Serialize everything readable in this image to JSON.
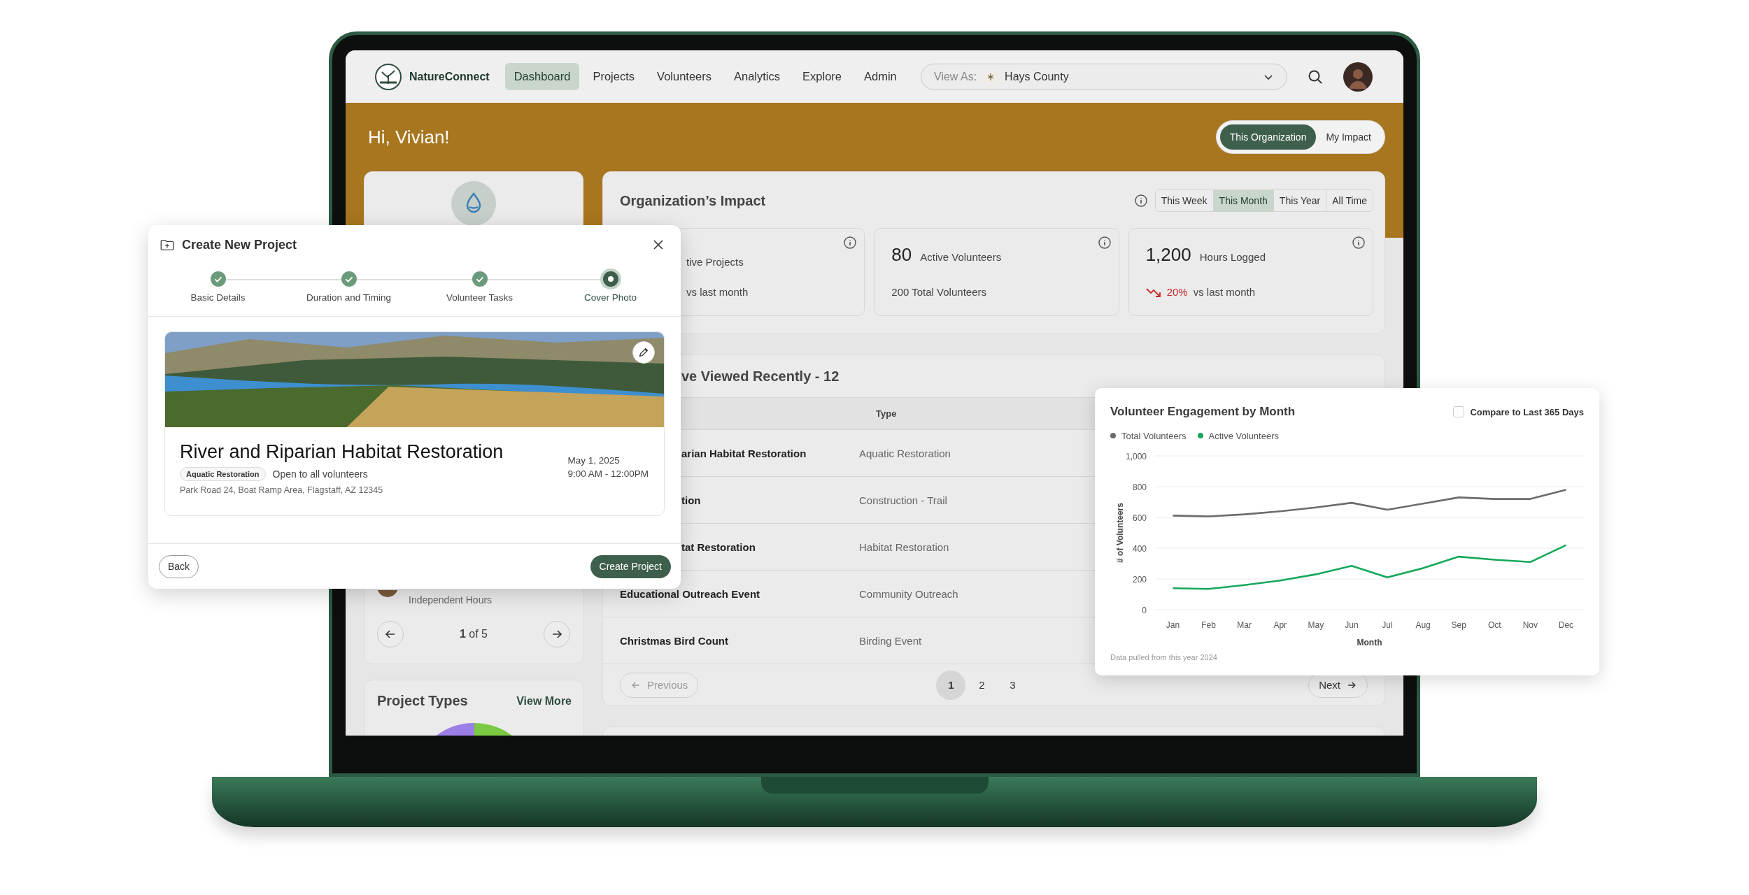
{
  "nav": {
    "brand": "NatureConnect",
    "items": [
      {
        "label": "Dashboard",
        "selected": true
      },
      {
        "label": "Projects",
        "selected": false
      },
      {
        "label": "Volunteers",
        "selected": false
      },
      {
        "label": "Analytics",
        "selected": false
      },
      {
        "label": "Explore",
        "selected": false
      },
      {
        "label": "Admin",
        "selected": false
      }
    ],
    "view_as": {
      "label": "View As:",
      "value": "Hays County"
    }
  },
  "greeting": "Hi, Vivian!",
  "scope_toggle": [
    {
      "label": "This Organization",
      "selected": true
    },
    {
      "label": "My Impact",
      "selected": false
    }
  ],
  "profile_card": {
    "subtitle": "Independent Hours",
    "pager": "**1** of 5"
  },
  "project_types": {
    "title": "Project Types",
    "link": "View More"
  },
  "impact": {
    "title": "Organization’s Impact",
    "periods": [
      {
        "label": "This Week",
        "selected": false
      },
      {
        "label": "This Month",
        "selected": true
      },
      {
        "label": "This Year",
        "selected": false
      },
      {
        "label": "All Time",
        "selected": false
      }
    ],
    "stats": [
      {
        "label": "tive Projects",
        "note": "vs last month"
      },
      {
        "value": "80",
        "label": "Active Volunteers",
        "note": "200 Total Volunteers"
      },
      {
        "value": "1,200",
        "label": "Hours Logged",
        "change": "20%",
        "rising": false,
        "note": "vs last month"
      }
    ]
  },
  "recent": {
    "title": "ve Viewed Recently - 12",
    "type_column": "Type",
    "rows": [
      {
        "name": "arian Habitat Restoration",
        "type": "Aquatic Restoration"
      },
      {
        "name": "tion",
        "type": "Construction - Trail"
      },
      {
        "name": "tat Restoration",
        "type": "Habitat Restoration"
      },
      {
        "name": "Educational Outreach Event",
        "type": "Community Outreach"
      },
      {
        "name": "Christmas Bird Count",
        "type": "Birding Event"
      }
    ],
    "pagination": {
      "previous": {
        "label": "Previous",
        "disabled": true
      },
      "pages": [
        {
          "label": "1",
          "selected": true
        },
        {
          "label": "2",
          "selected": false
        },
        {
          "label": "3",
          "selected": false
        }
      ],
      "next": {
        "label": "Next",
        "disabled": false
      }
    }
  },
  "modal": {
    "title": "Create New Project",
    "steps": [
      {
        "label": "Basic Details",
        "completed": true,
        "selected": false
      },
      {
        "label": "Duration and Timing",
        "completed": true,
        "selected": false
      },
      {
        "label": "Volunteer Tasks",
        "completed": true,
        "selected": false
      },
      {
        "label": "Cover Photo",
        "completed": false,
        "selected": true
      }
    ],
    "project": {
      "title": "River and Riparian Habitat Restoration",
      "tag": "Aquatic Restoration",
      "audience": "Open to all volunteers",
      "address": "Park Road 24, Boat Ramp Area, Flagstaff, AZ 12345",
      "date": "May 1, 2025",
      "time": "9:00 AM - 12:00PM"
    },
    "back": "Back",
    "submit": "Create Project"
  },
  "engagement_card": {
    "compare": {
      "label": "Compare to Last 365 Days",
      "checked": false
    },
    "note": "Data pulled from this year 2024",
    "chart_data": {
      "type": "line",
      "title": "Volunteer Engagement by Month",
      "xlabel": "Month",
      "ylabel": "# of Volunteers",
      "categories": [
        "Jan",
        "Feb",
        "Mar",
        "Apr",
        "May",
        "Jun",
        "Jul",
        "Aug",
        "Sep",
        "Oct",
        "Nov",
        "Dec"
      ],
      "series": [
        {
          "name": "Total Volunteers",
          "color": "#6b6b6b",
          "values": [
            612,
            607,
            620,
            640,
            665,
            695,
            650,
            690,
            730,
            720,
            720,
            780
          ]
        },
        {
          "name": "Active Volunteers",
          "color": "#16a85a",
          "values": [
            140,
            135,
            160,
            190,
            230,
            285,
            210,
            270,
            345,
            325,
            310,
            420
          ]
        }
      ],
      "ylim": [
        0,
        1000
      ],
      "grid": true,
      "yticks": [
        0,
        200,
        400,
        600,
        800,
        {
          "value": 1000,
          "label": "1,000"
        }
      ]
    }
  }
}
